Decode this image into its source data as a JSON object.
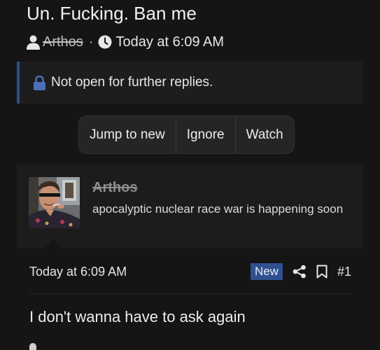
{
  "thread": {
    "title": "Un. Fucking. Ban me",
    "author": "Arthos",
    "separator": "·",
    "time": "Today at 6:09 AM"
  },
  "notice": {
    "text": "Not open for further replies."
  },
  "actions": {
    "jump_to_new": "Jump to new",
    "ignore": "Ignore",
    "watch": "Watch"
  },
  "post": {
    "username": "Arthos",
    "tagline": "apocalyptic nuclear race war is happening soon",
    "time": "Today at 6:09 AM",
    "badge": "New",
    "number": "#1",
    "body": "I don't wanna have to ask again"
  },
  "icons": {
    "meta_user": "user-icon",
    "meta_clock": "clock-icon",
    "notice_lock": "lock-icon",
    "share": "share-icon",
    "bookmark": "bookmark-icon"
  },
  "colors": {
    "background": "#151515",
    "card": "#1c1c1c",
    "accent_blue": "#2f4f8f"
  }
}
